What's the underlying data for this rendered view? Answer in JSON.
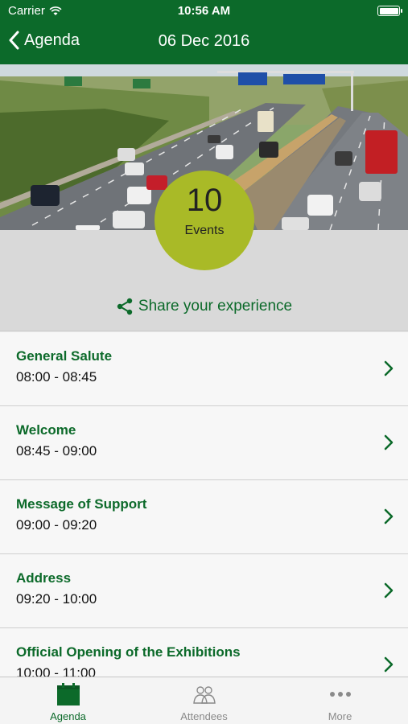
{
  "status_bar": {
    "carrier": "Carrier",
    "time": "10:56 AM"
  },
  "nav": {
    "back_label": "Agenda",
    "title": "06 Dec 2016"
  },
  "summary": {
    "count": "10",
    "count_label": "Events",
    "share_label": "Share your experience"
  },
  "events": [
    {
      "title": "General Salute",
      "time": "08:00 - 08:45"
    },
    {
      "title": "Welcome",
      "time": "08:45 - 09:00"
    },
    {
      "title": "Message of Support",
      "time": "09:00 - 09:20"
    },
    {
      "title": "Address",
      "time": "09:20 - 10:00"
    },
    {
      "title": "Official Opening of the Exhibitions",
      "time": "10:00 - 11:00"
    }
  ],
  "tabs": [
    {
      "label": "Agenda",
      "icon": "calendar-icon",
      "active": true
    },
    {
      "label": "Attendees",
      "icon": "people-icon",
      "active": false
    },
    {
      "label": "More",
      "icon": "more-icon",
      "active": false
    }
  ],
  "colors": {
    "brand_green": "#0c6a2a",
    "badge": "#a9ba27"
  }
}
